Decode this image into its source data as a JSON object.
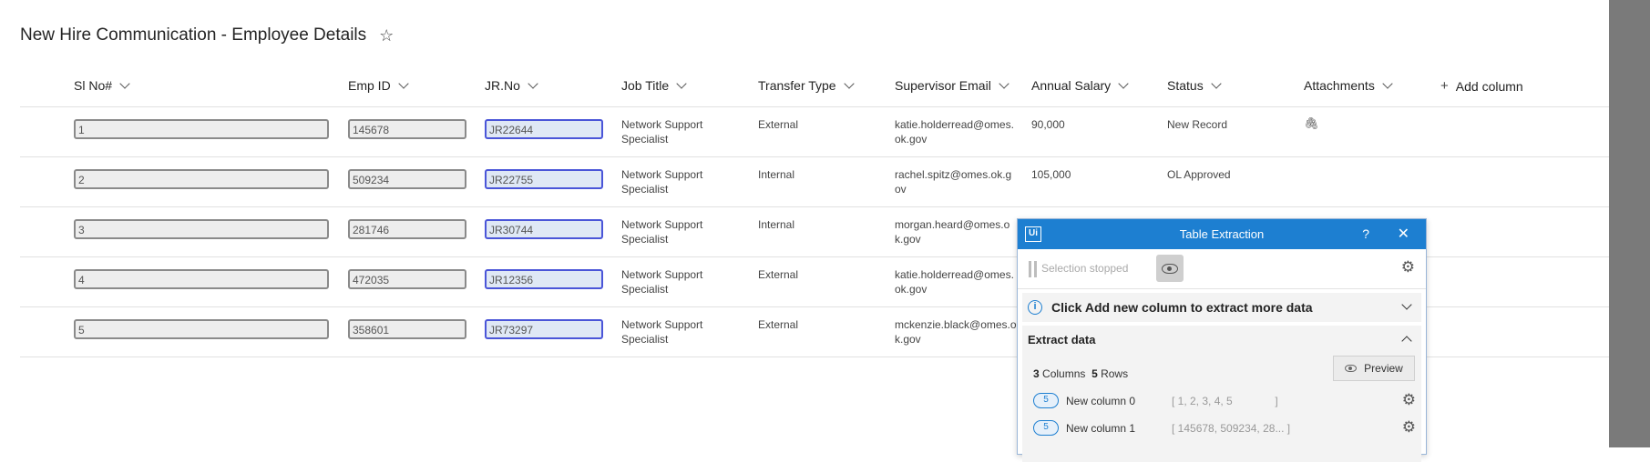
{
  "page": {
    "title": "New Hire Communication - Employee Details",
    "star_icon": "star-icon"
  },
  "table": {
    "columns": [
      "Sl No#",
      "Emp ID",
      "JR.No",
      "Job Title",
      "Transfer Type",
      "Supervisor Email",
      "Annual Salary",
      "Status",
      "Attachments"
    ],
    "add_column": "Add column",
    "rows": [
      {
        "sl": "1",
        "emp": "145678",
        "jr": "JR22644",
        "job1": "Network Support",
        "job2": "Specialist",
        "transfer": "External",
        "email1": "katie.holderread@omes.",
        "email2": "ok.gov",
        "salary": "90,000",
        "status": "New Record",
        "attachment": true
      },
      {
        "sl": "2",
        "emp": "509234",
        "jr": "JR22755",
        "job1": "Network Support",
        "job2": "Specialist",
        "transfer": "Internal",
        "email1": "rachel.spitz@omes.ok.g",
        "email2": "ov",
        "salary": "105,000",
        "status": "OL Approved",
        "attachment": false
      },
      {
        "sl": "3",
        "emp": "281746",
        "jr": "JR30744",
        "job1": "Network Support",
        "job2": "Specialist",
        "transfer": "Internal",
        "email1": "morgan.heard@omes.o",
        "email2": "k.gov",
        "salary": "",
        "status": "",
        "attachment": false
      },
      {
        "sl": "4",
        "emp": "472035",
        "jr": "JR12356",
        "job1": "Network Support",
        "job2": "Specialist",
        "transfer": "External",
        "email1": "katie.holderread@omes.",
        "email2": "ok.gov",
        "salary": "",
        "status": "",
        "attachment": false
      },
      {
        "sl": "5",
        "emp": "358601",
        "jr": "JR73297",
        "job1": "Network Support",
        "job2": "Specialist",
        "transfer": "External",
        "email1": "mckenzie.black@omes.o",
        "email2": "k.gov",
        "salary": "",
        "status": "",
        "attachment": false
      }
    ]
  },
  "panel": {
    "logo": "Ui",
    "title": "Table Extraction",
    "help": "?",
    "close": "✕",
    "selection_status": "Selection stopped",
    "info_message": "Click Add new column to extract more data",
    "extract_heading": "Extract data",
    "columns_count": "3",
    "columns_label": "Columns",
    "rows_count": "5",
    "rows_label": "Rows",
    "preview_label": "Preview",
    "extracted_columns": [
      {
        "count": "5",
        "name": "New column 0",
        "values": "[ 1, 2, 3, 4, 5              ]"
      },
      {
        "count": "5",
        "name": "New column 1",
        "values": "[ 145678, 509234, 28... ]"
      }
    ]
  }
}
